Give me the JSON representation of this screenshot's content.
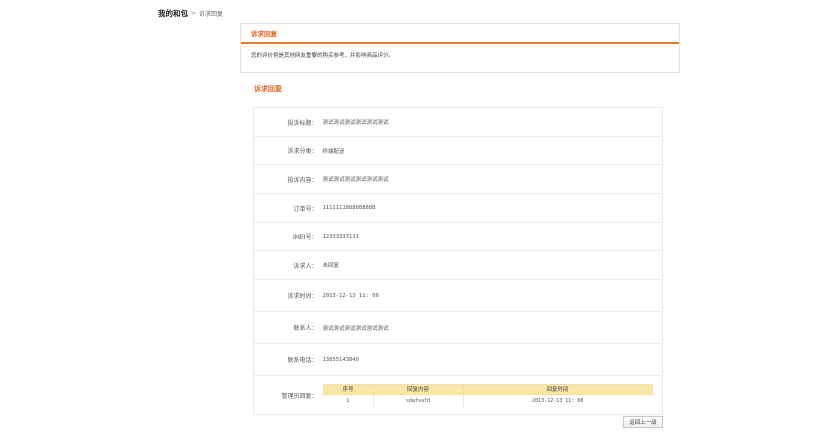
{
  "breadcrumb": {
    "root": "我的和包",
    "separator": ">",
    "current": "诉求回复"
  },
  "notice": {
    "title": "诉求回复",
    "text": "您的评价将是其他网友重要的购买参考，并影响商品评分。"
  },
  "section_title": "诉求回复",
  "details": [
    {
      "label": "投诉标题：",
      "value": "测试测试测试测试测试测试"
    },
    {
      "label": "诉求分类：",
      "value": "终端配送"
    },
    {
      "label": "投诉内容：",
      "value": "测试测试测试测试测试测试"
    },
    {
      "label": "订单号：",
      "value": "1111111888888888"
    },
    {
      "label": "IMEI号：",
      "value": "12333333111"
    },
    {
      "label": "诉求人：",
      "value": "未回复"
    },
    {
      "label": "诉求时间：",
      "value": "2013-12-13 11: 00"
    },
    {
      "label": "联系人：",
      "value": "测试测试测试测试测试测试"
    },
    {
      "label": "联系电话：",
      "value": "13855143840"
    }
  ],
  "admin_reply": {
    "label": "管理员回复：",
    "headers": [
      "序号",
      "回复内容",
      "回复时间"
    ],
    "rows": [
      {
        "no": "1",
        "content": "sdafsafd",
        "time": "2013-12-13 11: 00"
      }
    ]
  },
  "back_button": "返回上一级"
}
